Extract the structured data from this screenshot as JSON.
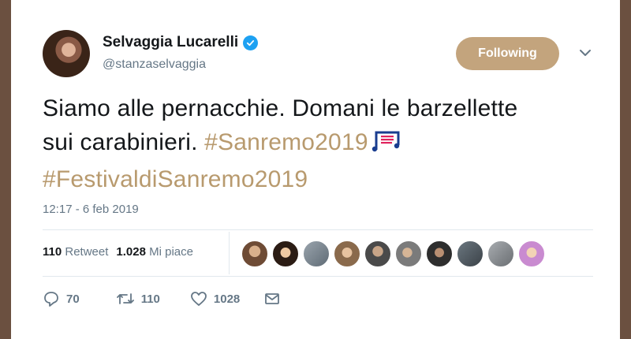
{
  "author": {
    "name": "Selvaggia Lucarelli",
    "handle": "@stanzaselvaggia",
    "verified": true
  },
  "follow_button": "Following",
  "tweet": {
    "text_line1": "Siamo alle pernacchie. Domani le barzellette",
    "text_line2_prefix": "sui carabinieri. ",
    "hashtag1": "#Sanremo2019",
    "emoji": "music-notes-icon",
    "hashtag2": "#FestivaldiSanremo2019",
    "timestamp": "12:17 - 6 feb 2019"
  },
  "stats": {
    "retweets_count": "110",
    "retweets_label": "Retweet",
    "likes_count": "1.028",
    "likes_label": "Mi piace"
  },
  "actions": {
    "reply": "70",
    "retweet": "110",
    "like": "1028"
  },
  "colors": {
    "accent": "#c3a47d",
    "hashtag": "#b89a6e",
    "verified": "#1da1f2",
    "muted": "#657786"
  }
}
